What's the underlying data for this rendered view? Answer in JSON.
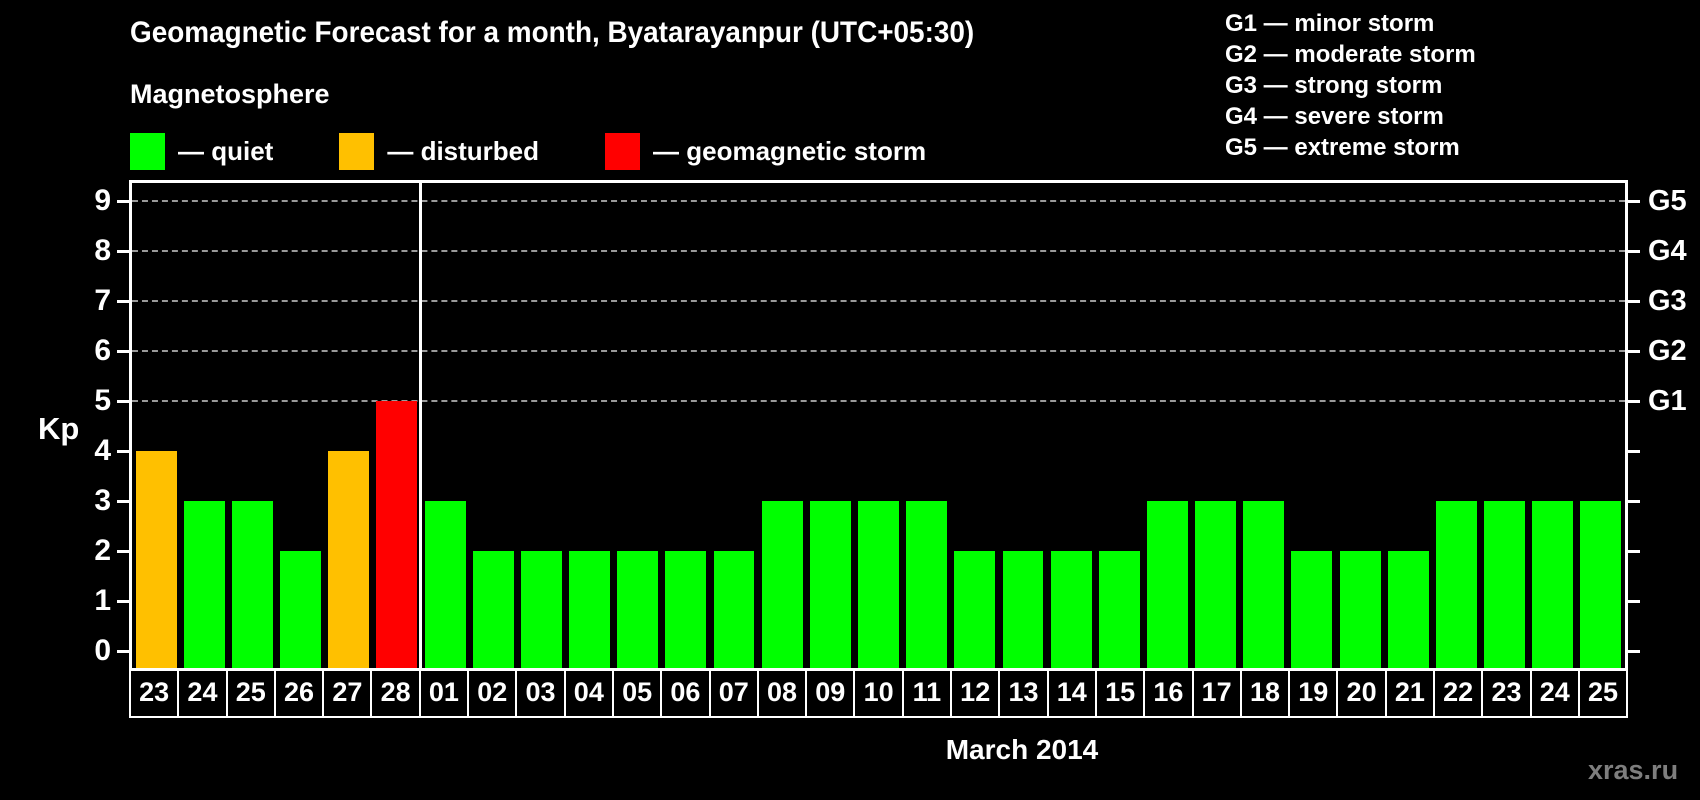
{
  "title": "Geomagnetic Forecast for a month, Byatarayanpur (UTC+05:30)",
  "watermark": "xras.ru",
  "magnetosphere_legend": {
    "heading": "Magnetosphere",
    "items": [
      {
        "id": "quiet",
        "label": "— quiet",
        "color": "#00ff00"
      },
      {
        "id": "disturbed",
        "label": "— disturbed",
        "color": "#ffc000"
      },
      {
        "id": "storm",
        "label": "— geomagnetic storm",
        "color": "#ff0000"
      }
    ]
  },
  "g_scale_legend": {
    "items": [
      "G1 — minor storm",
      "G2 — moderate storm",
      "G3 — strong storm",
      "G4 — severe storm",
      "G5 — extreme storm"
    ]
  },
  "chart_data": {
    "type": "bar",
    "title": "Geomagnetic Forecast for a month, Byatarayanpur (UTC+05:30)",
    "xlabel": "March 2014",
    "ylabel": "Kp",
    "ylim": [
      0,
      9
    ],
    "left_ticks": [
      0,
      1,
      2,
      3,
      4,
      5,
      6,
      7,
      8,
      9
    ],
    "gridlines_kp": [
      5,
      6,
      7,
      8,
      9
    ],
    "right_axis_labels": [
      {
        "label": "G1",
        "kp": 5
      },
      {
        "label": "G2",
        "kp": 6
      },
      {
        "label": "G3",
        "kp": 7
      },
      {
        "label": "G4",
        "kp": 8
      },
      {
        "label": "G5",
        "kp": 9
      }
    ],
    "month_separator_after_index": 5,
    "categories": [
      "23",
      "24",
      "25",
      "26",
      "27",
      "28",
      "01",
      "02",
      "03",
      "04",
      "05",
      "06",
      "07",
      "08",
      "09",
      "10",
      "11",
      "12",
      "13",
      "14",
      "15",
      "16",
      "17",
      "18",
      "19",
      "20",
      "21",
      "22",
      "23",
      "24",
      "25"
    ],
    "values": [
      4,
      3,
      3,
      2,
      4,
      5,
      3,
      2,
      2,
      2,
      2,
      2,
      2,
      3,
      3,
      3,
      3,
      2,
      2,
      2,
      2,
      3,
      3,
      3,
      2,
      2,
      2,
      3,
      3,
      3,
      3
    ],
    "statuses": [
      "disturbed",
      "quiet",
      "quiet",
      "quiet",
      "disturbed",
      "storm",
      "quiet",
      "quiet",
      "quiet",
      "quiet",
      "quiet",
      "quiet",
      "quiet",
      "quiet",
      "quiet",
      "quiet",
      "quiet",
      "quiet",
      "quiet",
      "quiet",
      "quiet",
      "quiet",
      "quiet",
      "quiet",
      "quiet",
      "quiet",
      "quiet",
      "quiet",
      "quiet",
      "quiet",
      "quiet"
    ],
    "status_colors": {
      "quiet": "#00ff00",
      "disturbed": "#ffc000",
      "storm": "#ff0000"
    },
    "legend_position": "top-left",
    "grid": "dashed horizontal at G-levels only"
  }
}
